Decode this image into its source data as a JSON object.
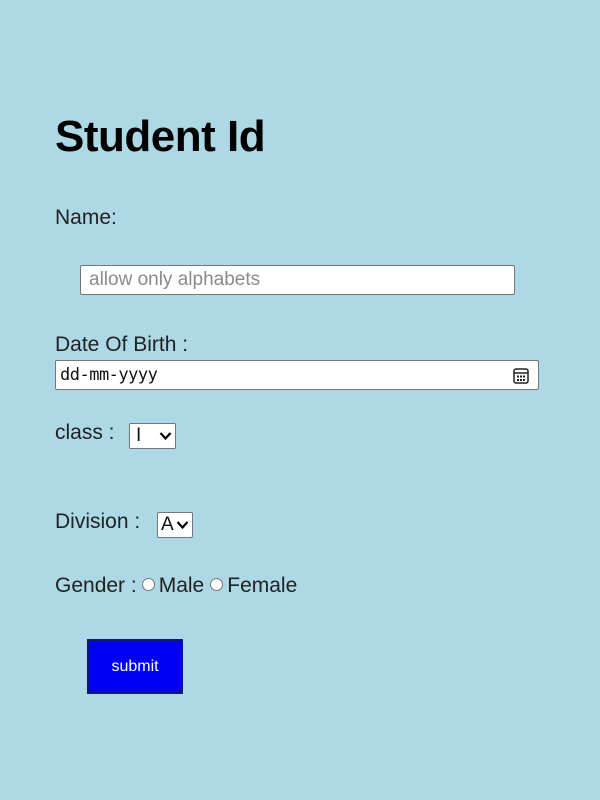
{
  "page": {
    "title": "Student Id",
    "background_color": "#add8e6"
  },
  "form": {
    "name_label": "Name:",
    "name_placeholder": "allow only alphabets",
    "name_value": "",
    "dob_label": "Date Of Birth :",
    "dob_display": "dd-mm-yyyy",
    "class_label": "class :",
    "class_selected": "I",
    "division_label": "Division :",
    "division_selected": "A",
    "gender_label": "Gender :",
    "gender_options": [
      {
        "label": "Male",
        "checked": false
      },
      {
        "label": "Female",
        "checked": false
      }
    ],
    "submit_label": "submit",
    "submit_color": "#0000f5"
  },
  "icons": {
    "date_picker": "calendar-icon",
    "select_arrow": "chevron-down-icon",
    "radio": "radio-button-icon"
  }
}
